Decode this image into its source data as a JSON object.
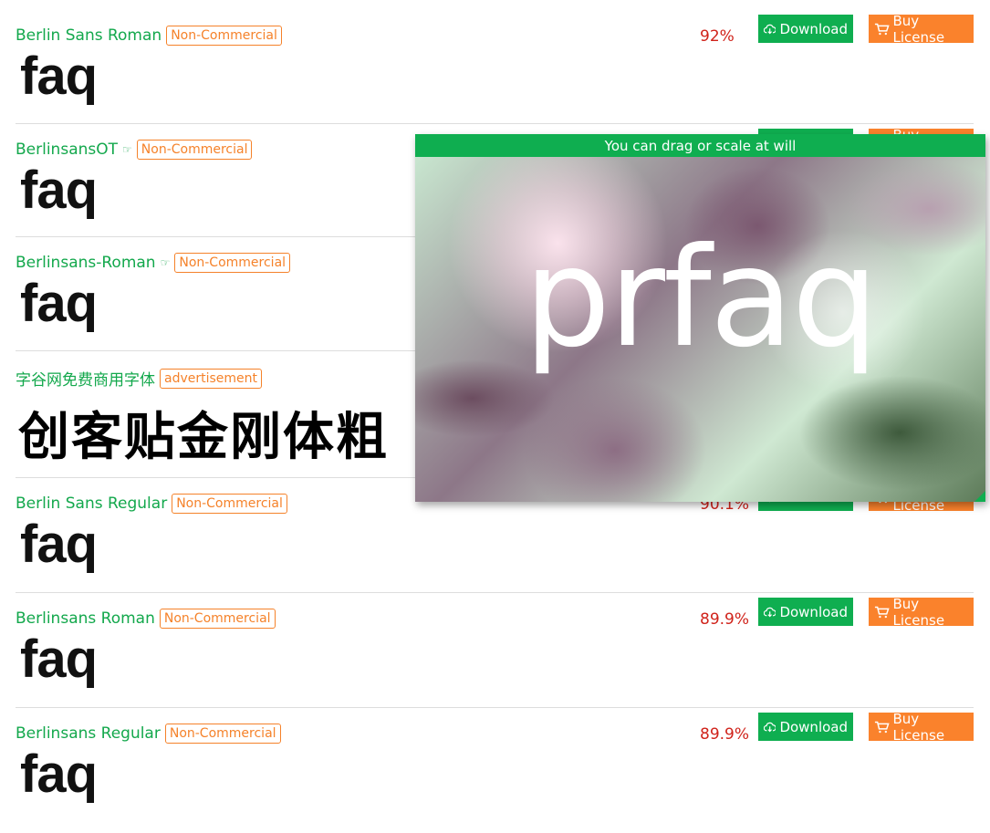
{
  "buttons": {
    "download": "Download",
    "buy": "Buy License"
  },
  "rows": [
    {
      "name": "Berlin Sans Roman",
      "badge": "Non-Commercial",
      "pct": "92%",
      "sample": "faq"
    },
    {
      "name": "BerlinsansOT",
      "badge": "Non-Commercial",
      "sample": "faq",
      "hand": "☞"
    },
    {
      "name": "Berlinsans-Roman",
      "badge": "Non-Commercial",
      "sample": "faq",
      "hand": "☞"
    },
    {
      "name": "字谷网免费商用字体",
      "badge": "advertisement",
      "sample": "创客贴金刚体粗"
    },
    {
      "name": "Berlin Sans Regular",
      "badge": "Non-Commercial",
      "pct": "90.1%",
      "sample": "faq"
    },
    {
      "name": "Berlinsans Roman",
      "badge": "Non-Commercial",
      "pct": "89.9%",
      "sample": "faq"
    },
    {
      "name": "Berlinsans Regular",
      "badge": "Non-Commercial",
      "pct": "89.9%",
      "sample": "faq"
    }
  ],
  "overlay": {
    "title": "You can drag or scale at will",
    "preview_text": "prfaq"
  }
}
